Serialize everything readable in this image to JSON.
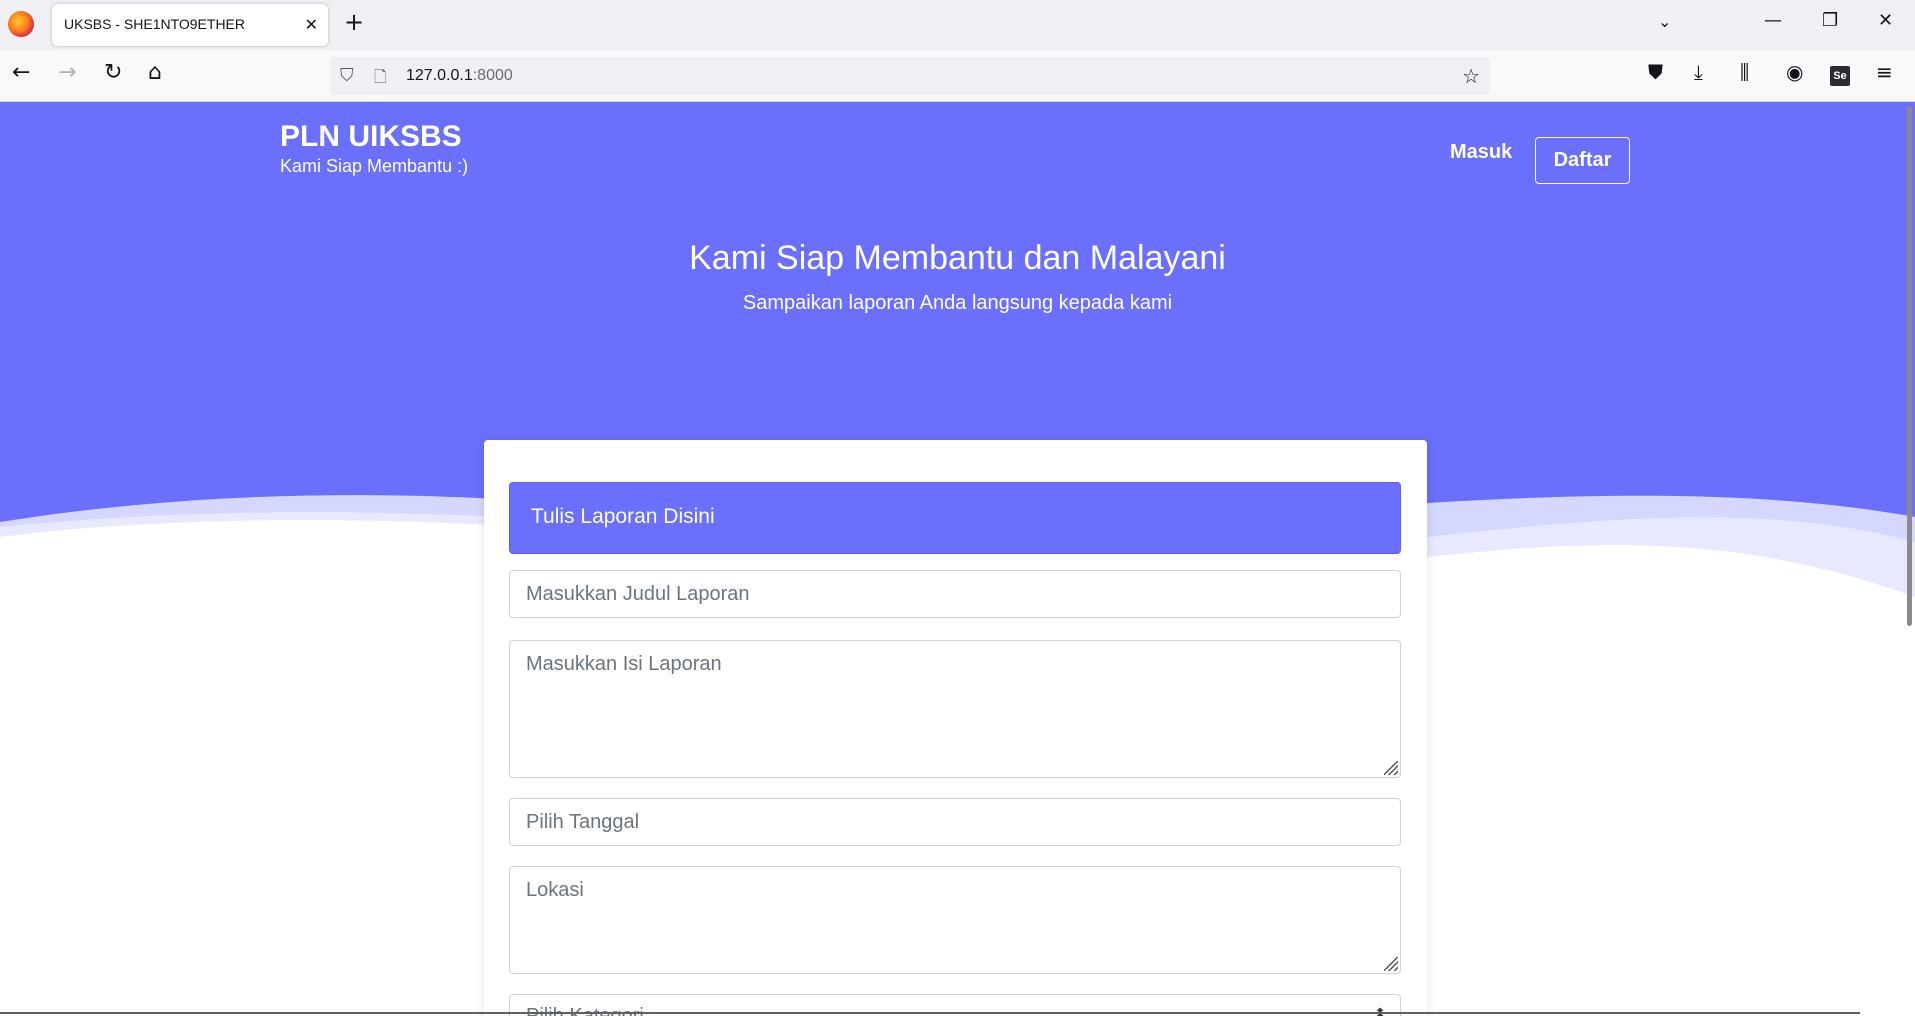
{
  "browser": {
    "tab_title": "UKSBS - SHE1NTO9ETHER",
    "url_host": "127.0.0.1",
    "url_port": ":8000"
  },
  "site": {
    "brand_title": "PLN UIKSBS",
    "brand_subtitle": "Kami Siap Membantu :)",
    "nav_login": "Masuk",
    "nav_register": "Daftar"
  },
  "hero": {
    "title": "Kami Siap Membantu dan Malayani",
    "subtitle": "Sampaikan laporan Anda langsung kepada kami"
  },
  "form": {
    "header": "Tulis Laporan Disini",
    "title_placeholder": "Masukkan Judul Laporan",
    "body_placeholder": "Masukkan Isi Laporan",
    "date_placeholder": "Pilih Tanggal",
    "location_placeholder": "Lokasi",
    "category_selected": "Pilih Kategori"
  },
  "colors": {
    "primary": "#6a6ffc"
  }
}
